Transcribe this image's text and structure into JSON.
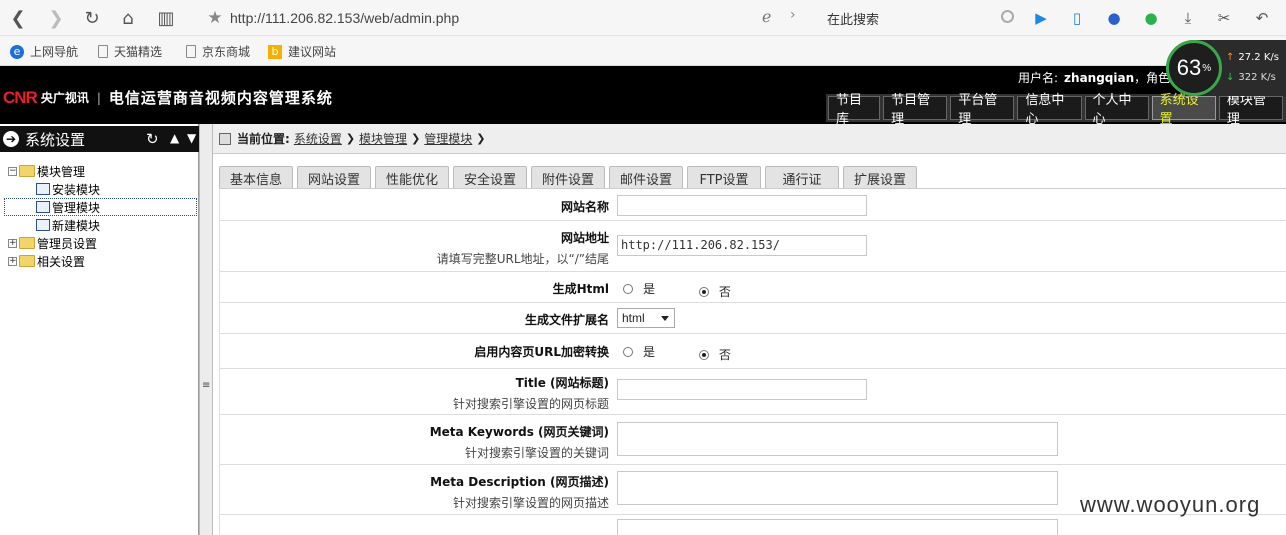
{
  "browser": {
    "url": "http://111.206.82.153/web/admin.php",
    "search_placeholder": "在此搜索",
    "bookmarks": [
      "上网导航",
      "天猫精选",
      "京东商城",
      "建议网站"
    ]
  },
  "speed_widget": {
    "percent": "63",
    "percent_unit": "%",
    "upload": "27.2",
    "upload_unit": "K/s",
    "download": "322",
    "download_unit": "K/s"
  },
  "header": {
    "logo_cnr": "CNR",
    "logo_name": "央广视讯",
    "system_title": "电信运营商音视频内容管理系统",
    "user_label": "用户名:",
    "username": "zhangqian",
    "role_label": "，角色",
    "nav": [
      "节目库",
      "节目管理",
      "平台管理",
      "信息中心",
      "个人中心",
      "系统设置",
      "模块管理"
    ],
    "active_nav": "系统设置"
  },
  "sidebar": {
    "title": "系统设置",
    "tree": [
      {
        "label": "模块管理",
        "type": "folder",
        "expanded": true
      },
      {
        "label": "安装模块",
        "type": "module"
      },
      {
        "label": "管理模块",
        "type": "module",
        "selected": true
      },
      {
        "label": "新建模块",
        "type": "module"
      },
      {
        "label": "管理员设置",
        "type": "folder",
        "expanded": false
      },
      {
        "label": "相关设置",
        "type": "folder",
        "expanded": false
      }
    ]
  },
  "breadcrumb": {
    "label": "当前位置:",
    "items": [
      "系统设置",
      "模块管理",
      "管理模块"
    ]
  },
  "tabs": [
    "基本信息",
    "网站设置",
    "性能优化",
    "安全设置",
    "附件设置",
    "邮件设置",
    "FTP设置",
    "通行证",
    "扩展设置"
  ],
  "form": {
    "site_name": {
      "label": "网站名称",
      "value": ""
    },
    "site_url": {
      "label": "网站地址",
      "hint": "请填写完整URL地址，以“/”结尾",
      "value": "http://111.206.82.153/"
    },
    "gen_html": {
      "label": "生成Html",
      "yes": "是",
      "no": "否",
      "selected": "否"
    },
    "ext": {
      "label": "生成文件扩展名",
      "value": "html"
    },
    "url_encrypt": {
      "label": "启用内容页URL加密转换",
      "yes": "是",
      "no": "否",
      "selected": "否"
    },
    "title": {
      "label": "Title (网站标题)",
      "hint": "针对搜索引擎设置的网页标题",
      "value": ""
    },
    "keywords": {
      "label": "Meta Keywords (网页关键词)",
      "hint": "针对搜索引擎设置的关键词",
      "value": ""
    },
    "description": {
      "label": "Meta Description (网页描述)",
      "hint": "针对搜索引擎设置的网页描述",
      "value": ""
    }
  },
  "watermark": "www.wooyun.org"
}
